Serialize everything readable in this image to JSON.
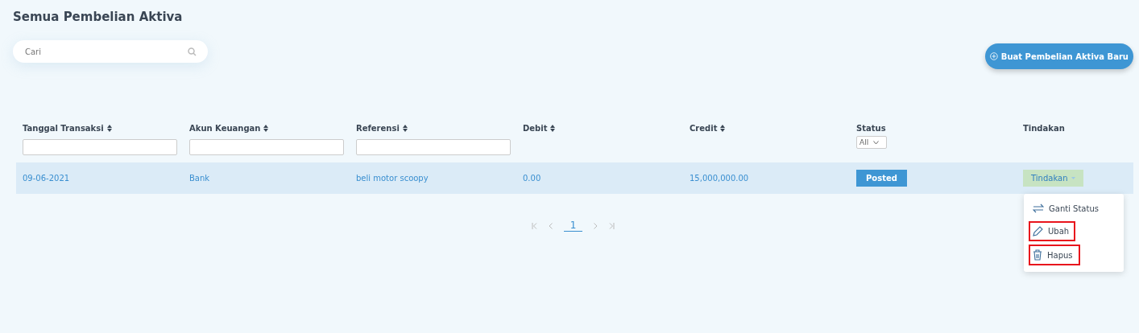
{
  "title": "Semua Pembelian Aktiva",
  "search": {
    "placeholder": "Cari"
  },
  "create_button": {
    "label": "Buat Pembelian Aktiva Baru"
  },
  "table": {
    "columns": [
      {
        "label": "Tanggal Transaksi",
        "sortable": true,
        "kind": "text_filter"
      },
      {
        "label": "Akun Keuangan",
        "sortable": true,
        "kind": "text_filter"
      },
      {
        "label": "Referensi",
        "sortable": true,
        "kind": "text_filter"
      },
      {
        "label": "Debit",
        "sortable": true,
        "kind": "plain"
      },
      {
        "label": "Credit",
        "sortable": true,
        "kind": "plain"
      },
      {
        "label": "Status",
        "sortable": false,
        "kind": "select_filter",
        "filter_value": "All"
      },
      {
        "label": "Tindakan",
        "sortable": false,
        "kind": "plain"
      }
    ],
    "rows": [
      {
        "tanggal": "09-06-2021",
        "akun": "Bank",
        "referensi": "beli motor scoopy",
        "debit": "0.00",
        "credit": "15,000,000.00",
        "status": "Posted",
        "action": "Tindakan",
        "menu_open": true
      }
    ]
  },
  "action_menu": [
    {
      "label": "Ganti Status",
      "kind": "status",
      "highlighted": false
    },
    {
      "label": "Ubah",
      "kind": "edit",
      "highlighted": true
    },
    {
      "label": "Hapus",
      "kind": "delete",
      "highlighted": true
    }
  ],
  "pagination": {
    "pages": [
      {
        "label": "1",
        "selected": true
      }
    ]
  }
}
